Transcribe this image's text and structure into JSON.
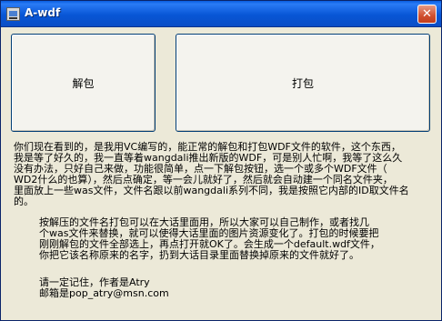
{
  "window": {
    "title": "A-wdf",
    "close_glyph": "✕"
  },
  "buttons": {
    "unpack_label": "解包",
    "pack_label": "打包"
  },
  "text": {
    "para1": "你们现在看到的，是我用VC编写的，能正常的解包和打包WDF文件的软件，这个东西，\n我是等了好久的，我一直等着wangdali推出新版的WDF，可是别人忙啊，我等了这么久\n没有办法，只好自己来做，功能很简单，点一下解包按钮，选一个或多个WDF文件（\nWD2什么的也算），然后点确定，等一会儿就好了，然后就会自动建一个同名文件夹，\n里面放上一些was文件，文件名跟以前wangdali系列不同，我是按照它内部的ID取文件名\n的。",
    "para2": "按解压的文件名打包可以在大话里面用，所以大家可以自己制作，或者找几\n个was文件来替换，就可以使得大话里面的图片资源变化了。打包的时候要把\n刚刚解包的文件全部选上，再点打开就OK了。会生成一个default.wdf文件，\n你把它该名称原来的名字，扔到大话目录里面替换掉原来的文件就好了。",
    "para3": "请一定记住，作者是Atry\n邮箱是pop_atry@msn.com"
  }
}
